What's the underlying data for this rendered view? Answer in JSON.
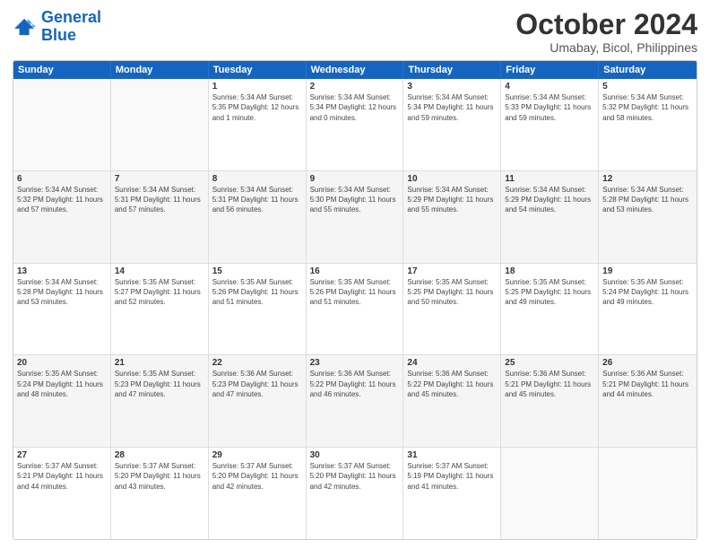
{
  "logo": {
    "line1": "General",
    "line2": "Blue"
  },
  "title": "October 2024",
  "subtitle": "Umabay, Bicol, Philippines",
  "dayNames": [
    "Sunday",
    "Monday",
    "Tuesday",
    "Wednesday",
    "Thursday",
    "Friday",
    "Saturday"
  ],
  "weeks": [
    [
      {
        "date": "",
        "info": ""
      },
      {
        "date": "",
        "info": ""
      },
      {
        "date": "1",
        "info": "Sunrise: 5:34 AM\nSunset: 5:35 PM\nDaylight: 12 hours\nand 1 minute."
      },
      {
        "date": "2",
        "info": "Sunrise: 5:34 AM\nSunset: 5:34 PM\nDaylight: 12 hours\nand 0 minutes."
      },
      {
        "date": "3",
        "info": "Sunrise: 5:34 AM\nSunset: 5:34 PM\nDaylight: 11 hours\nand 59 minutes."
      },
      {
        "date": "4",
        "info": "Sunrise: 5:34 AM\nSunset: 5:33 PM\nDaylight: 11 hours\nand 59 minutes."
      },
      {
        "date": "5",
        "info": "Sunrise: 5:34 AM\nSunset: 5:32 PM\nDaylight: 11 hours\nand 58 minutes."
      }
    ],
    [
      {
        "date": "6",
        "info": "Sunrise: 5:34 AM\nSunset: 5:32 PM\nDaylight: 11 hours\nand 57 minutes."
      },
      {
        "date": "7",
        "info": "Sunrise: 5:34 AM\nSunset: 5:31 PM\nDaylight: 11 hours\nand 57 minutes."
      },
      {
        "date": "8",
        "info": "Sunrise: 5:34 AM\nSunset: 5:31 PM\nDaylight: 11 hours\nand 56 minutes."
      },
      {
        "date": "9",
        "info": "Sunrise: 5:34 AM\nSunset: 5:30 PM\nDaylight: 11 hours\nand 55 minutes."
      },
      {
        "date": "10",
        "info": "Sunrise: 5:34 AM\nSunset: 5:29 PM\nDaylight: 11 hours\nand 55 minutes."
      },
      {
        "date": "11",
        "info": "Sunrise: 5:34 AM\nSunset: 5:29 PM\nDaylight: 11 hours\nand 54 minutes."
      },
      {
        "date": "12",
        "info": "Sunrise: 5:34 AM\nSunset: 5:28 PM\nDaylight: 11 hours\nand 53 minutes."
      }
    ],
    [
      {
        "date": "13",
        "info": "Sunrise: 5:34 AM\nSunset: 5:28 PM\nDaylight: 11 hours\nand 53 minutes."
      },
      {
        "date": "14",
        "info": "Sunrise: 5:35 AM\nSunset: 5:27 PM\nDaylight: 11 hours\nand 52 minutes."
      },
      {
        "date": "15",
        "info": "Sunrise: 5:35 AM\nSunset: 5:26 PM\nDaylight: 11 hours\nand 51 minutes."
      },
      {
        "date": "16",
        "info": "Sunrise: 5:35 AM\nSunset: 5:26 PM\nDaylight: 11 hours\nand 51 minutes."
      },
      {
        "date": "17",
        "info": "Sunrise: 5:35 AM\nSunset: 5:25 PM\nDaylight: 11 hours\nand 50 minutes."
      },
      {
        "date": "18",
        "info": "Sunrise: 5:35 AM\nSunset: 5:25 PM\nDaylight: 11 hours\nand 49 minutes."
      },
      {
        "date": "19",
        "info": "Sunrise: 5:35 AM\nSunset: 5:24 PM\nDaylight: 11 hours\nand 49 minutes."
      }
    ],
    [
      {
        "date": "20",
        "info": "Sunrise: 5:35 AM\nSunset: 5:24 PM\nDaylight: 11 hours\nand 48 minutes."
      },
      {
        "date": "21",
        "info": "Sunrise: 5:35 AM\nSunset: 5:23 PM\nDaylight: 11 hours\nand 47 minutes."
      },
      {
        "date": "22",
        "info": "Sunrise: 5:36 AM\nSunset: 5:23 PM\nDaylight: 11 hours\nand 47 minutes."
      },
      {
        "date": "23",
        "info": "Sunrise: 5:36 AM\nSunset: 5:22 PM\nDaylight: 11 hours\nand 46 minutes."
      },
      {
        "date": "24",
        "info": "Sunrise: 5:36 AM\nSunset: 5:22 PM\nDaylight: 11 hours\nand 45 minutes."
      },
      {
        "date": "25",
        "info": "Sunrise: 5:36 AM\nSunset: 5:21 PM\nDaylight: 11 hours\nand 45 minutes."
      },
      {
        "date": "26",
        "info": "Sunrise: 5:36 AM\nSunset: 5:21 PM\nDaylight: 11 hours\nand 44 minutes."
      }
    ],
    [
      {
        "date": "27",
        "info": "Sunrise: 5:37 AM\nSunset: 5:21 PM\nDaylight: 11 hours\nand 44 minutes."
      },
      {
        "date": "28",
        "info": "Sunrise: 5:37 AM\nSunset: 5:20 PM\nDaylight: 11 hours\nand 43 minutes."
      },
      {
        "date": "29",
        "info": "Sunrise: 5:37 AM\nSunset: 5:20 PM\nDaylight: 11 hours\nand 42 minutes."
      },
      {
        "date": "30",
        "info": "Sunrise: 5:37 AM\nSunset: 5:20 PM\nDaylight: 11 hours\nand 42 minutes."
      },
      {
        "date": "31",
        "info": "Sunrise: 5:37 AM\nSunset: 5:19 PM\nDaylight: 11 hours\nand 41 minutes."
      },
      {
        "date": "",
        "info": ""
      },
      {
        "date": "",
        "info": ""
      }
    ]
  ]
}
